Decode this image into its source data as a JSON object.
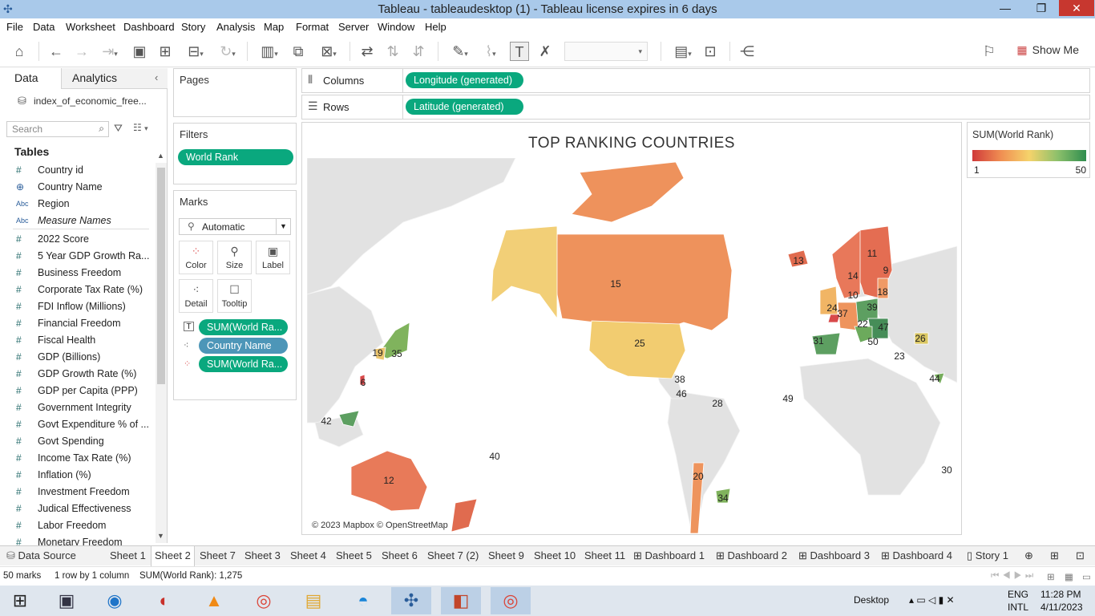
{
  "window": {
    "title": "Tableau - tableaudesktop (1) - Tableau license expires in 6 days",
    "minimize": "—",
    "restore": "❐",
    "close": "✕"
  },
  "menu": [
    "File",
    "Data",
    "Worksheet",
    "Dashboard",
    "Story",
    "Analysis",
    "Map",
    "Format",
    "Server",
    "Window",
    "Help"
  ],
  "toolbar": {
    "show_me": "Show Me"
  },
  "data_pane": {
    "tab_data": "Data",
    "tab_analytics": "Analytics",
    "datasource": "index_of_economic_free...",
    "search_placeholder": "Search",
    "tables_heading": "Tables",
    "fields": [
      {
        "icon": "#",
        "name": "Country id"
      },
      {
        "icon": "⊕",
        "name": "Country Name"
      },
      {
        "icon": "Abc",
        "name": "Region"
      },
      {
        "icon": "Abc",
        "name": "Measure Names"
      },
      {
        "icon": "#",
        "name": "2022 Score"
      },
      {
        "icon": "#",
        "name": "5 Year GDP Growth Ra..."
      },
      {
        "icon": "#",
        "name": "Business Freedom"
      },
      {
        "icon": "#",
        "name": "Corporate Tax Rate (%)"
      },
      {
        "icon": "#",
        "name": "FDI Inflow (Millions)"
      },
      {
        "icon": "#",
        "name": "Financial Freedom"
      },
      {
        "icon": "#",
        "name": "Fiscal Health"
      },
      {
        "icon": "#",
        "name": "GDP (Billions)"
      },
      {
        "icon": "#",
        "name": "GDP Growth Rate (%)"
      },
      {
        "icon": "#",
        "name": "GDP per Capita (PPP)"
      },
      {
        "icon": "#",
        "name": "Government Integrity"
      },
      {
        "icon": "#",
        "name": "Govt Expenditure % of ..."
      },
      {
        "icon": "#",
        "name": "Govt Spending"
      },
      {
        "icon": "#",
        "name": "Income Tax Rate (%)"
      },
      {
        "icon": "#",
        "name": "Inflation (%)"
      },
      {
        "icon": "#",
        "name": "Investment Freedom"
      },
      {
        "icon": "#",
        "name": "Judical Effectiveness"
      },
      {
        "icon": "#",
        "name": "Labor Freedom"
      },
      {
        "icon": "#",
        "name": "Monetary Freedom"
      }
    ]
  },
  "pages": {
    "title": "Pages"
  },
  "filters": {
    "title": "Filters",
    "pill": "World Rank"
  },
  "marks": {
    "title": "Marks",
    "type": "Automatic",
    "buttons": [
      "Color",
      "Size",
      "Label",
      "Detail",
      "Tooltip"
    ],
    "pills": [
      "SUM(World Ra...",
      "Country Name",
      "SUM(World Ra..."
    ]
  },
  "shelves": {
    "columns_label": "Columns",
    "columns_pill": "Longitude (generated)",
    "rows_label": "Rows",
    "rows_pill": "Latitude (generated)"
  },
  "viz": {
    "title": "TOP RANKING COUNTRIES",
    "copyright": "© 2023 Mapbox © OpenStreetMap",
    "labels": [
      "15",
      "25",
      "13",
      "11",
      "9",
      "14",
      "10",
      "18",
      "24",
      "39",
      "37",
      "22",
      "47",
      "50",
      "31",
      "26",
      "23",
      "44",
      "49",
      "28",
      "38",
      "46",
      "19",
      "35",
      "6",
      "42",
      "40",
      "12",
      "20",
      "34",
      "30"
    ]
  },
  "legend": {
    "title": "SUM(World Rank)",
    "min": "1",
    "max": "50",
    "colors": [
      "#d03a3a",
      "#f08e52",
      "#f5d36b",
      "#8cc06b",
      "#2f8d4e"
    ]
  },
  "sheet_tabs": [
    "Data Source",
    "Sheet 1",
    "Sheet 2",
    "Sheet 7",
    "Sheet 3",
    "Sheet 4",
    "Sheet 5",
    "Sheet 6",
    "Sheet 7 (2)",
    "Sheet 9",
    "Sheet 10",
    "Sheet 11",
    "Dashboard 1",
    "Dashboard 2",
    "Dashboard 3",
    "Dashboard 4",
    "Story 1"
  ],
  "active_tab": "Sheet 2",
  "status": {
    "marks": "50 marks",
    "rows_cols": "1 row by 1 column",
    "sum": "SUM(World Rank): 1,275"
  },
  "taskbar": {
    "desktop": "Desktop",
    "lang1": "ENG",
    "lang2": "INTL",
    "time": "11:28 PM",
    "date": "4/11/2023"
  }
}
